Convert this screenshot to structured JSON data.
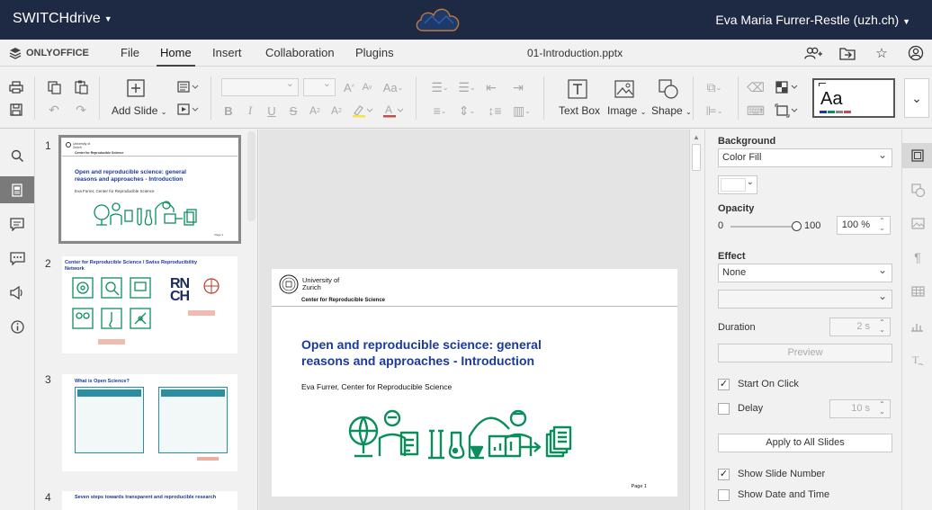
{
  "header": {
    "app_title": "SWITCHdrive",
    "user": "Eva Maria Furrer-Restle (uzh.ch)"
  },
  "menubar": {
    "brand": "ONLYOFFICE",
    "tabs": [
      "File",
      "Home",
      "Insert",
      "Collaboration",
      "Plugins"
    ],
    "active_tab": "Home",
    "document_title": "01-Introduction.pptx"
  },
  "toolbar": {
    "add_slide": "Add Slide",
    "text_box": "Text Box",
    "image": "Image",
    "shape": "Shape",
    "theme_preview": "Aa"
  },
  "thumbnails": [
    {
      "num": "1",
      "title": "Open and reproducible science: general reasons and approaches - Introduction",
      "subtitle": "Eva Furrer, Center for Reproducible Science",
      "header": "Center for Reproducible Science"
    },
    {
      "num": "2",
      "title": "Center for Reproducible Science / Swiss Reproducibility Network",
      "logo": "RN CH"
    },
    {
      "num": "3",
      "title": "What is Open Science?"
    },
    {
      "num": "4",
      "title": "Seven steps towards transparent and reproducible research"
    }
  ],
  "slide": {
    "university": "University of Zurich",
    "header": "Center for Reproducible Science",
    "title": "Open and reproducible science: general reasons and approaches - Introduction",
    "author": "Eva Furrer, Center for Reproducible Science",
    "page_label": "Page 1"
  },
  "right_panel": {
    "background_label": "Background",
    "fill_value": "Color Fill",
    "opacity_label": "Opacity",
    "opacity_min": "0",
    "opacity_max": "100",
    "opacity_value": "100 %",
    "opacity_fraction": 1.0,
    "effect_label": "Effect",
    "effect_value": "None",
    "duration_label": "Duration",
    "duration_value": "2 s",
    "preview_label": "Preview",
    "start_on_click": "Start On Click",
    "start_on_click_checked": true,
    "delay_label": "Delay",
    "delay_value": "10 s",
    "delay_checked": false,
    "apply_all": "Apply to All Slides",
    "show_slide_number": "Show Slide Number",
    "show_slide_number_checked": true,
    "show_date_time": "Show Date and Time",
    "show_date_time_checked": false
  },
  "colors": {
    "topbar": "#1e2a44",
    "slide_title": "#1a3a9c",
    "illustration": "#0a8f5c"
  }
}
